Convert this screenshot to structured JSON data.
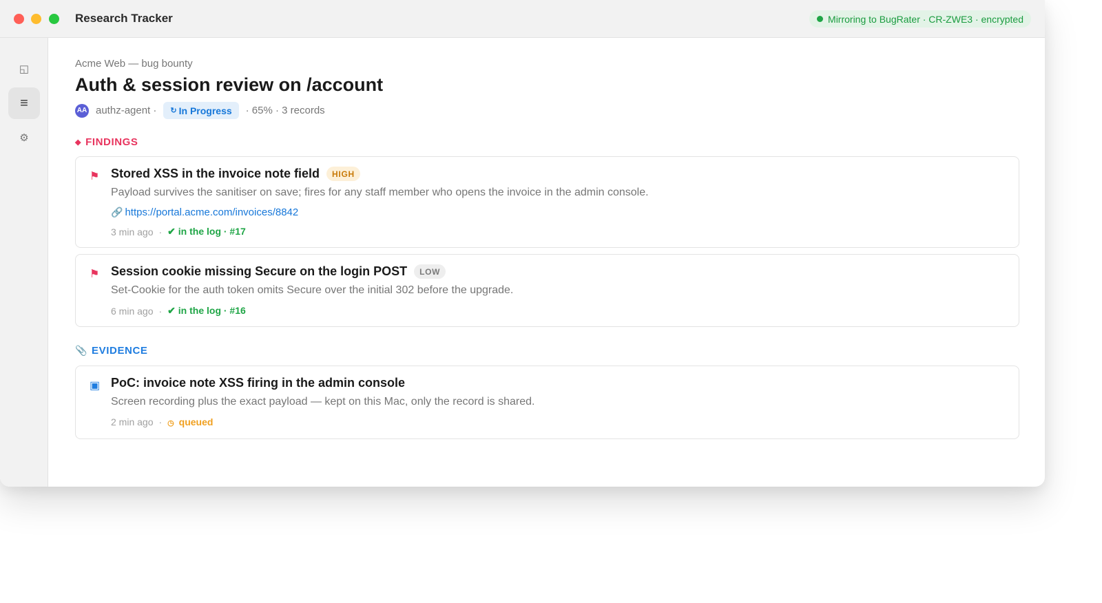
{
  "window": {
    "title": "Research Tracker",
    "sync_status": "Mirroring to BugRater · CR-ZWE3 · encrypted"
  },
  "sidebar": {
    "items": [
      {
        "icon": "panel-icon",
        "glyph": "◱"
      },
      {
        "icon": "list-icon",
        "glyph": "≡"
      },
      {
        "icon": "gear-icon",
        "glyph": "⚙"
      }
    ]
  },
  "header": {
    "breadcrumb": "Acme Web — bug bounty",
    "title": "Auth & session review on /account",
    "avatar_initials": "AA",
    "agent": "authz-agent ·",
    "status_icon": "↻",
    "status": "In Progress",
    "summary": "· 65% · 3 records"
  },
  "findings": {
    "section_icon": "◆",
    "label": "FINDINGS",
    "items": [
      {
        "icon_glyph": "⚑",
        "title": "Stored XSS in the invoice note field",
        "severity": "HIGH",
        "description": "Payload survives the sanitiser on save; fires for any staff member who opens the invoice in the admin console.",
        "link_icon": "🔗",
        "link": "https://portal.acme.com/invoices/8842",
        "time": "3 min ago",
        "sep": "·",
        "log_status": "✔ in the log · #17"
      },
      {
        "icon_glyph": "⚑",
        "title": "Session cookie missing Secure on the login POST",
        "severity": "LOW",
        "description": "Set-Cookie for the auth token omits Secure over the initial 302 before the upgrade.",
        "time": "6 min ago",
        "sep": "·",
        "log_status": "✔ in the log · #16"
      }
    ]
  },
  "evidence": {
    "section_icon": "📎",
    "label": "EVIDENCE",
    "items": [
      {
        "icon_glyph": "▣",
        "title": "PoC: invoice note XSS firing in the admin console",
        "description": "Screen recording plus the exact payload — kept on this Mac, only the record is shared.",
        "time": "2 min ago",
        "sep": "·",
        "queue_icon": "◷",
        "queue_status": "queued"
      }
    ]
  },
  "colors": {
    "accent_blue": "#1677d9",
    "findings_red": "#e8345e",
    "success_green": "#1fa546",
    "queued_orange": "#f0a020",
    "severity_high": "#c87a09"
  }
}
